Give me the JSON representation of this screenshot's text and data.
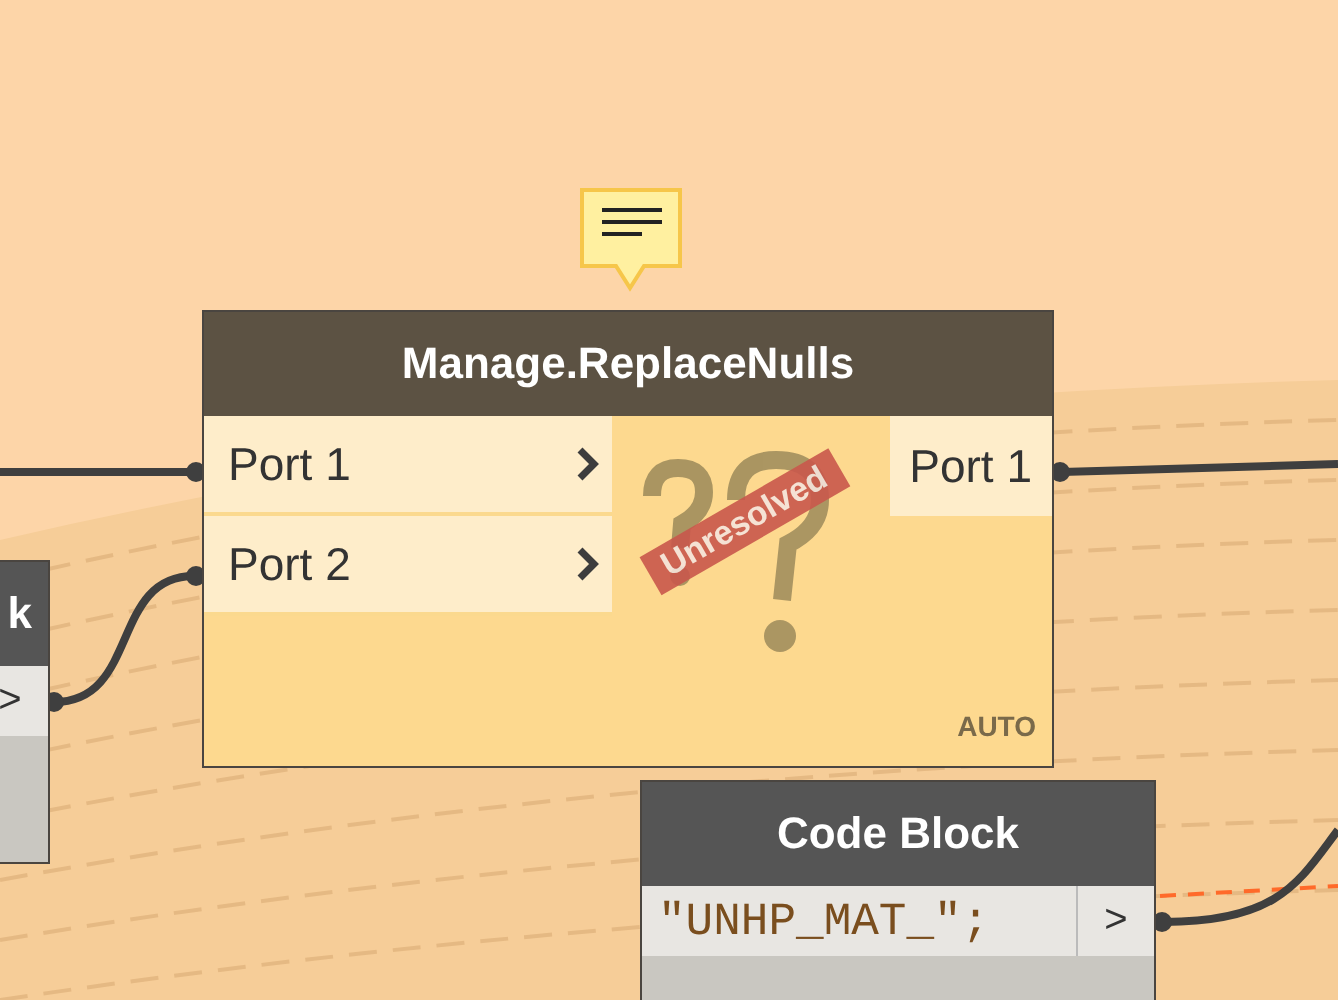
{
  "nodes": [
    {
      "kind": "partial",
      "title": "k",
      "outputs": [
        ">"
      ]
    },
    {
      "kind": "function",
      "title": "Manage.ReplaceNulls",
      "inputs": [
        "Port 1",
        "Port 2"
      ],
      "outputs": [
        "Port 1"
      ],
      "badge": "Unresolved",
      "run_mode": "AUTO",
      "has_comment": true
    },
    {
      "kind": "code",
      "title": "Code Block",
      "code": "\"UNHP_MAT_\";",
      "outputs": [
        ">"
      ]
    }
  ]
}
